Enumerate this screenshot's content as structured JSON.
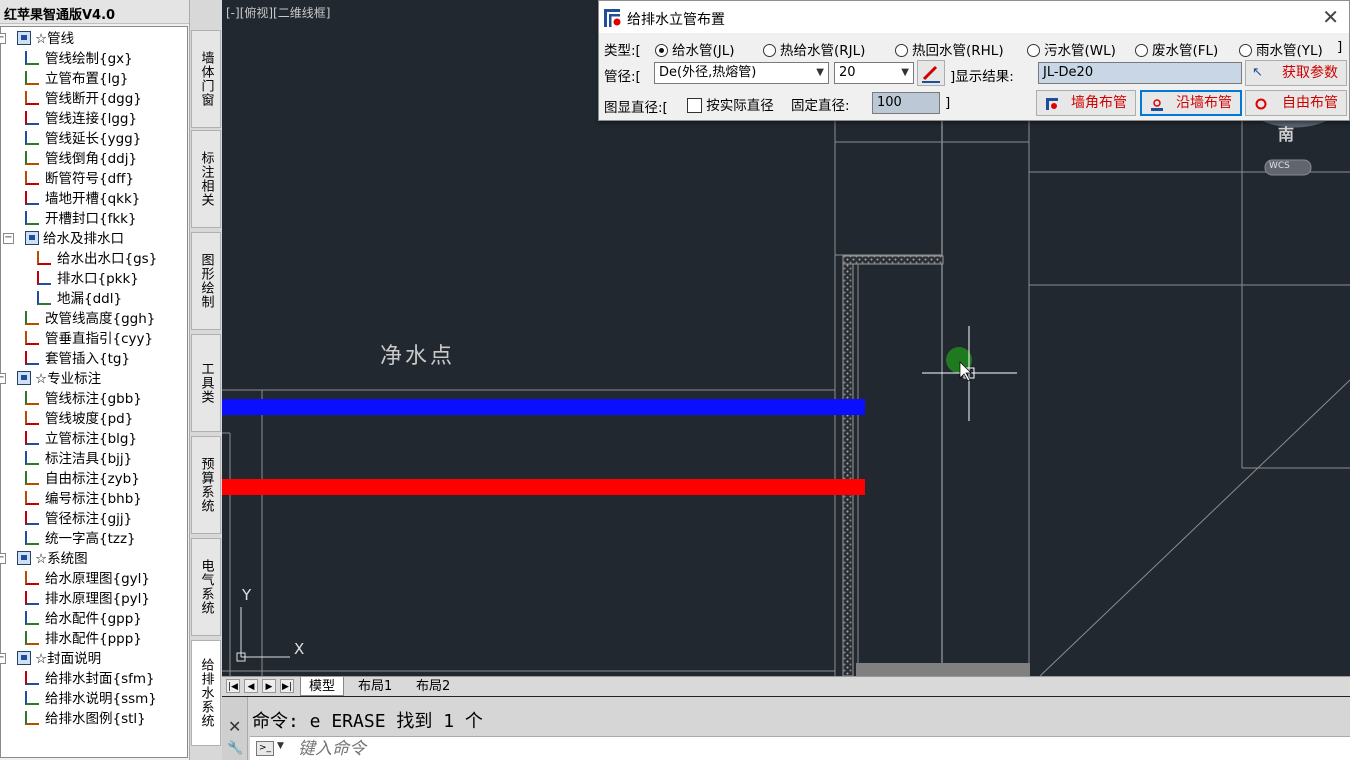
{
  "app": {
    "title": "红苹果智通版V4.0"
  },
  "tree": {
    "items": [
      {
        "label": "☆管线",
        "level": 0
      },
      {
        "label": "管线绘制{gx}",
        "level": 1
      },
      {
        "label": "立管布置{lg}",
        "level": 1
      },
      {
        "label": "管线断开{dgg}",
        "level": 1
      },
      {
        "label": "管线连接{lgg}",
        "level": 1
      },
      {
        "label": "管线延长{ygg}",
        "level": 1
      },
      {
        "label": "管线倒角{ddj}",
        "level": 1
      },
      {
        "label": "断管符号{dff}",
        "level": 1
      },
      {
        "label": "墙地开槽{qkk}",
        "level": 1
      },
      {
        "label": "开槽封口{fkk}",
        "level": 1
      },
      {
        "label": "给水及排水口",
        "level": 1
      },
      {
        "label": "给水出水口{gs}",
        "level": 2
      },
      {
        "label": "排水口{pkk}",
        "level": 2
      },
      {
        "label": "地漏{ddl}",
        "level": 2
      },
      {
        "label": "改管线高度{ggh}",
        "level": 1
      },
      {
        "label": "管垂直指引{cyy}",
        "level": 1
      },
      {
        "label": "套管插入{tg}",
        "level": 1
      },
      {
        "label": "☆专业标注",
        "level": 0
      },
      {
        "label": "管线标注{gbb}",
        "level": 1
      },
      {
        "label": "管线坡度{pd}",
        "level": 1
      },
      {
        "label": "立管标注{blg}",
        "level": 1
      },
      {
        "label": "标注洁具{bjj}",
        "level": 1
      },
      {
        "label": "自由标注{zyb}",
        "level": 1
      },
      {
        "label": "编号标注{bhb}",
        "level": 1
      },
      {
        "label": "管径标注{gjj}",
        "level": 1
      },
      {
        "label": "统一字高{tzz}",
        "level": 1
      },
      {
        "label": "☆系统图",
        "level": 0
      },
      {
        "label": "给水原理图{gyl}",
        "level": 1
      },
      {
        "label": "排水原理图{pyl}",
        "level": 1
      },
      {
        "label": "给水配件{gpp}",
        "level": 1
      },
      {
        "label": "排水配件{ppp}",
        "level": 1
      },
      {
        "label": "☆封面说明",
        "level": 0
      },
      {
        "label": "给排水封面{sfm}",
        "level": 1
      },
      {
        "label": "给排水说明{ssm}",
        "level": 1
      },
      {
        "label": "给排水图例{stl}",
        "level": 1
      }
    ]
  },
  "vtabs": [
    "墙体门窗",
    "标注相关",
    "图形绘制",
    "工具类",
    "预算系统",
    "电气系统",
    "给排水系统"
  ],
  "canvas": {
    "view_label": "[-][俯视][二维线框]",
    "text": "净水点",
    "compass_label": "南",
    "wcs_label": "WCS",
    "axis_y": "Y",
    "axis_x": "X",
    "pipe_colors": {
      "blue": "#0a10ff",
      "red": "#ff0000"
    }
  },
  "layout_tabs": [
    "模型",
    "布局1",
    "布局2"
  ],
  "command": {
    "history": "命令: e ERASE 找到 1 个",
    "placeholder": "键入命令"
  },
  "dialog": {
    "title": "给排水立管布置",
    "type_label": "类型:[",
    "types": [
      "给水管(JL)",
      "热给水管(RJL)",
      "热回水管(RHL)",
      "污水管(WL)",
      "废水管(FL)",
      "雨水管(YL)"
    ],
    "types_end": "]",
    "selected_type": "给水管(JL)",
    "diameter_label": "管径:[",
    "diameter_kind": "De(外径,热熔管)",
    "diameter_value": "20",
    "result_label": "]显示结果:",
    "result_value": "JL-De20",
    "get_params": "获取参数",
    "display_label": "图显直径:[",
    "actual_label": "按实际直径",
    "fixed_label": "固定直径:",
    "fixed_value": "100",
    "display_end": "]",
    "btn_corner": "墙角布管",
    "btn_wall": "沿墙布管",
    "btn_free": "自由布管"
  }
}
